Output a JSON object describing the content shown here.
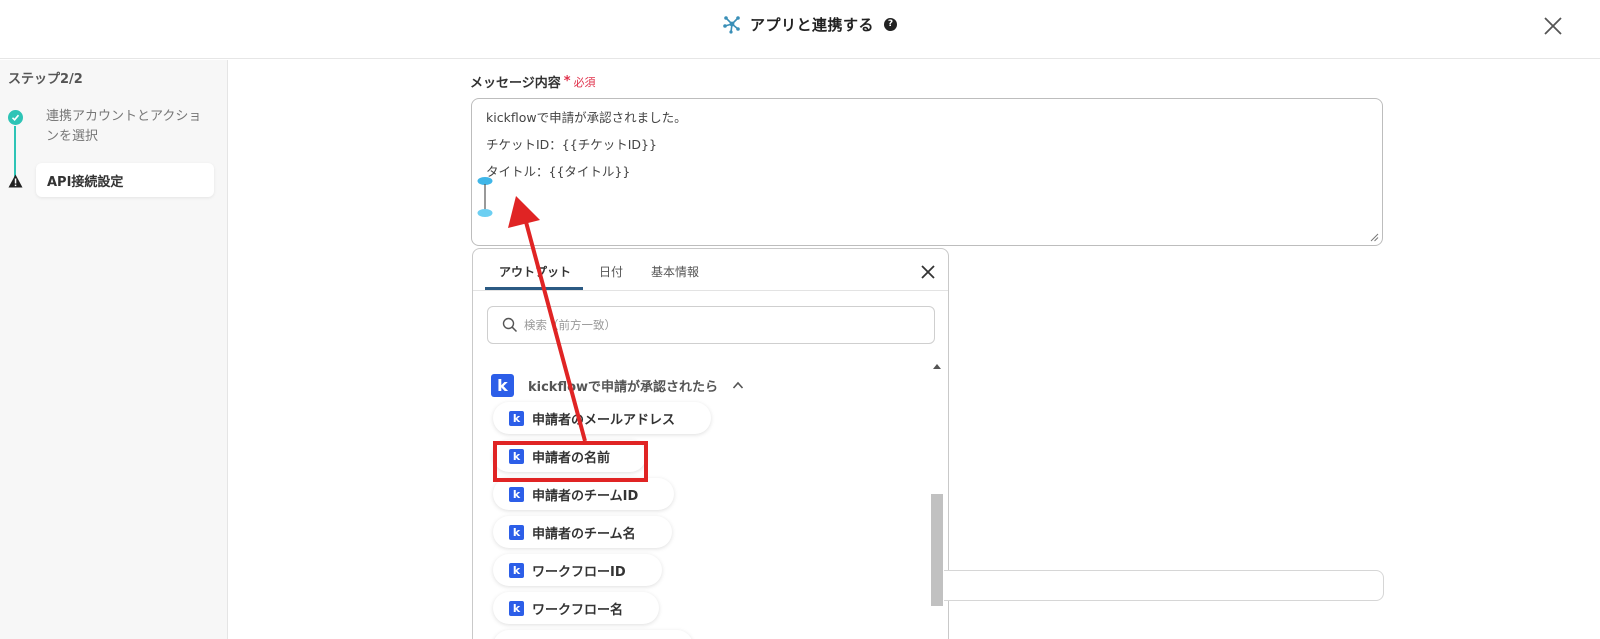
{
  "header": {
    "title": "アプリと連携する",
    "help_glyph": "?"
  },
  "sidebar": {
    "step_label": "ステップ2/2",
    "steps": [
      {
        "label": "連携アカウントとアクションを選択",
        "state": "done"
      },
      {
        "label": "API接続設定",
        "state": "current-warning"
      }
    ]
  },
  "main": {
    "field_label": "メッセージ内容",
    "required_star": "*",
    "required_text": "必須",
    "message_lines": [
      "kickflowで申請が承認されました。",
      "チケットID：{{チケットID}}",
      "タイトル：{{タイトル}}"
    ]
  },
  "popup": {
    "tabs": [
      {
        "label": "アウトプット",
        "active": true
      },
      {
        "label": "日付",
        "active": false
      },
      {
        "label": "基本情報",
        "active": false
      }
    ],
    "search_placeholder": "検索（前方一致）",
    "group": {
      "logo_letter": "k",
      "title": "kickflowで申請が承認されたら",
      "items": [
        "申請者のメールアドレス",
        "申請者の名前",
        "申請者のチームID",
        "申請者のチーム名",
        "ワークフローID",
        "ワークフロー名"
      ]
    }
  },
  "colors": {
    "accent_teal": "#2ec4b6",
    "kickflow_blue": "#2c5ee8",
    "annotation_red": "#e02424",
    "required_red": "#e0314b",
    "tab_underline": "#2b5a83"
  }
}
